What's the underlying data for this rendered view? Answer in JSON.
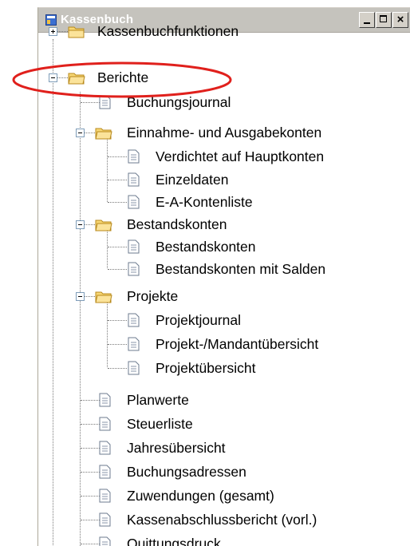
{
  "window": {
    "title": "Kassenbuch",
    "title_bar_color": "#c5c3bd",
    "caption_buttons": {
      "close_symbol": "×"
    }
  },
  "tree": {
    "items": [
      {
        "label": "Kassenbuchfunktionen",
        "type": "folder",
        "state": "collapsed"
      },
      {
        "label": "Berichte",
        "type": "folder",
        "state": "expanded",
        "highlighted": true
      },
      {
        "label": "Buchungsjournal",
        "type": "document"
      },
      {
        "label": "Einnahme- und Ausgabekonten",
        "type": "folder",
        "state": "expanded"
      },
      {
        "label": "Verdichtet auf Hauptkonten",
        "type": "document"
      },
      {
        "label": "Einzeldaten",
        "type": "document"
      },
      {
        "label": "E-A-Kontenliste",
        "type": "document"
      },
      {
        "label": "Bestandskonten",
        "type": "folder",
        "state": "expanded"
      },
      {
        "label": "Bestandskonten",
        "type": "document"
      },
      {
        "label": "Bestandskonten mit Salden",
        "type": "document"
      },
      {
        "label": "Projekte",
        "type": "folder",
        "state": "expanded"
      },
      {
        "label": "Projektjournal",
        "type": "document"
      },
      {
        "label": "Projekt-/Mandantübersicht",
        "type": "document"
      },
      {
        "label": "Projektübersicht",
        "type": "document"
      },
      {
        "label": "Planwerte",
        "type": "document"
      },
      {
        "label": "Steuerliste",
        "type": "document"
      },
      {
        "label": "Jahresübersicht",
        "type": "document"
      },
      {
        "label": "Buchungsadressen",
        "type": "document"
      },
      {
        "label": "Zuwendungen (gesamt)",
        "type": "document"
      },
      {
        "label": "Kassenabschlussbericht (vorl.)",
        "type": "document"
      },
      {
        "label": "Quittungsdruck",
        "type": "document"
      }
    ]
  },
  "annotation": {
    "color": "#e0201c"
  }
}
